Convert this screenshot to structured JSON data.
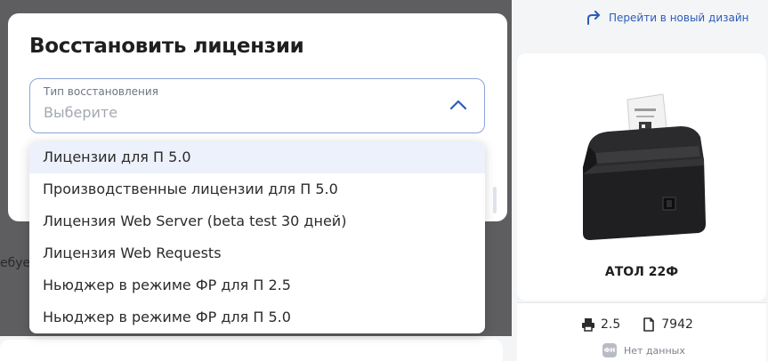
{
  "modal": {
    "title": "Восстановить лицензии",
    "select": {
      "label": "Тип восстановления",
      "placeholder": "Выберите"
    }
  },
  "dropdown": {
    "items": [
      "Лицензии для П 5.0",
      "Производственные лицензии для П 5.0",
      "Лицензия Web Server (beta test 30 дней)",
      "Лицензия Web Requests",
      "Ньюджер в режиме ФР для П 2.5",
      "Ньюджер в режиме ФР для П 5.0"
    ],
    "highlighted_index": 0
  },
  "background": {
    "partial_text": "ебуе"
  },
  "header": {
    "new_design_link": "Перейти в новый дизайн"
  },
  "device": {
    "name": "АТОЛ 22Ф",
    "version": "2.5",
    "document_count": "7942",
    "fn_badge": "ФН",
    "fn_status": "Нет данных"
  },
  "colors": {
    "accent": "#2d5cb8",
    "overlay": "#5e5e61",
    "highlight": "#edf1fb"
  }
}
